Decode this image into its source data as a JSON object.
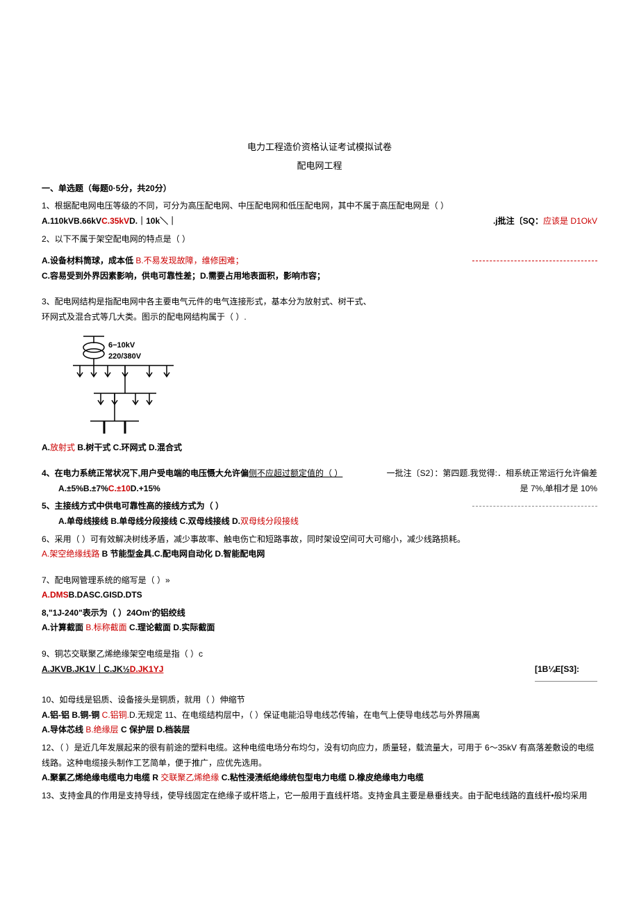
{
  "title": "电力工程造价资格认证考试模拟试卷",
  "subtitle": "配电网工程",
  "section1": "一、单选题（每题0·5分，共20分）",
  "q1": {
    "stem": "1、根据配电网电压等级的不同，可分为高压配电网、中压配电网和低压配电网，其中不属于高压配电网是（ ）",
    "opts": "A.110kVB.66kV",
    "optC": "C.35kV",
    "optD": "D.｜10k＼｜",
    "annot": ".j批注〔SQ：",
    "annot2": "应该是 D1OkV"
  },
  "q2": {
    "stem": "2、以下不属于架空配电网的特点是（ ）",
    "optA": "A.设备材料筒球，成本低 ",
    "optB": "B.不易发现故障，维修困难；",
    "optC": "C.容易受到外界因素影响，供电可靠性差；",
    "optD": "D.需要占用地表面积，影响市容；"
  },
  "q3": {
    "stem1": "3、配电网结构是指配电网中各主要电气元件的电气连接形式，基本分为放射式、树干式、",
    "stem2": "环网式及混合式等几大类。图示的配电网结构属于（ ）.",
    "diagramLabel1": "6−10kV",
    "diagramLabel2": "220/380V",
    "optA_pre": "A.",
    "optA": "放射式",
    "rest": " B.树干式 C.环网式 D.混合式"
  },
  "q4": {
    "stem_pre": "4、在电力系统正常状况下,用户受电端的电压慑大允许偏",
    "stem_u": "侧不应超过额定值的（ ）",
    "annot1": "一批注〔S2〕：第四题.我觉得:．相系统正常运行允许偏差",
    "opts": "A.±5%B.±7%",
    "optC": "C.±10",
    "optD": "D.+15%",
    "annot2": "是 7%,单相才是 10%"
  },
  "q5": {
    "stem": "5、主接线方式中供电可靠性高的接线方式为（ ）",
    "opts": "A.单母线接线 B.单母线分段接线 C.双母线接线 D.",
    "optD": "双母线分段接线"
  },
  "q6": {
    "stem": "6、采用（ ）可有效解决树线矛盾，减少事故率、触电伤亡和短路事故，同时架设空间可大可缩小，减少线路损耗。",
    "optA": "A.架空绝缘线路",
    "rest": " B 节能型金具.C.配电网自动化 D.智能配电网"
  },
  "q7": {
    "stem": "7、配电网管理系统的缩写是（ ）»",
    "optA": "A.DMS",
    "rest": "B.DASC.GISD.DTS"
  },
  "q8": {
    "stem_pre": "8,\"1J-240\"表示为（            ）24Om‘的铝绞线",
    "optA": "A.计算截面 ",
    "optB": "B.标称截面",
    "rest": " C.理论截面 D.实际截面"
  },
  "q9": {
    "stem": "9、铜芯交联聚乙烯绝缘架空电缆是指（ ）c",
    "opts_pre": "A.JKVB.JK1V｜C.JK½",
    "optD": "D.JK1YJ",
    "annot": "[1B¼E[S3]:"
  },
  "q10": {
    "stem": "10、如母线是铝质、设备接头是铜质，就用（ ）伸缩节",
    "opts_pre": "A.铝-铝 B.铜-铜 ",
    "optC": "C.铝铜.",
    "rest": "D.无规定 11、在电缆结构层中，（ ）保证电能沿导电线芯传输，在电气上使导电线芯与外界隔离",
    "line2_pre": "A.导体芯线 ",
    "line2_b": "B.绝缘层",
    "line2_rest": " C 保护层 D.档装层"
  },
  "q12": {
    "stem1": "12、（ ）是近几年发展起来的很有前途的塑料电缆。这种电缆电场分布均匀，没有切向应力，质量轻，载流量大，可用于 6～35kV 有高落差敷设的电缆线路。这种电缆接头制作工艺简单，便于推广，应优先选用。",
    "optA": "A.聚氯乙烯绝缘电缆电力电缆 R ",
    "optB": "交联聚乙烯绝缘",
    "rest": " C.粘性浸渍纸绝缘统包型电力电缆 D.橡皮绝缘电力电缆"
  },
  "q13": {
    "stem": "13、支持金具的作用是支持导线，使导线固定在绝缘子或杆塔上，它一般用于直线杆塔。支持金具主要是悬垂线夹。由于配电线路的直线杆•般均采用"
  }
}
